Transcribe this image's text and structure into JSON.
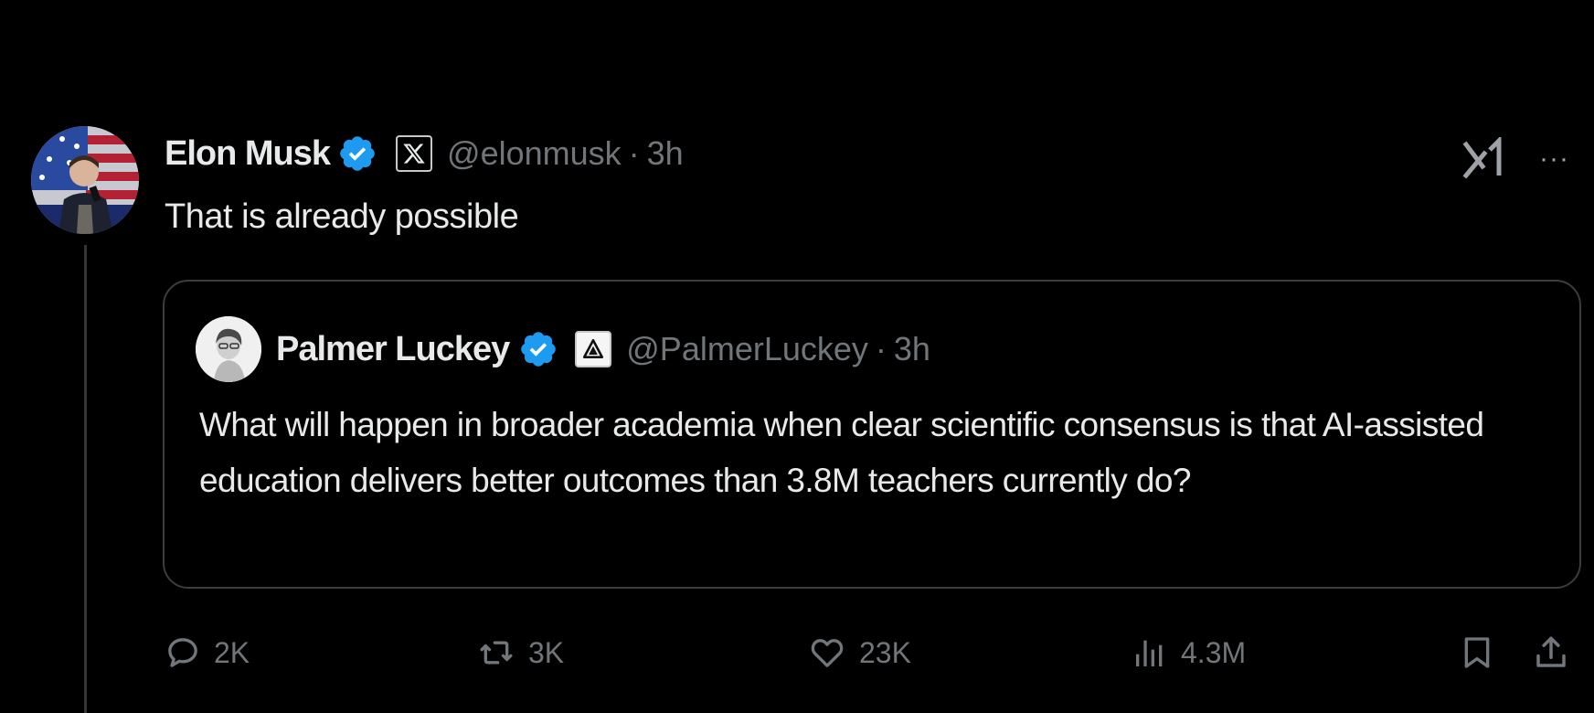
{
  "post": {
    "author": {
      "name": "Elon Musk",
      "handle": "@elonmusk",
      "time": "3h",
      "affiliation_icon": "x-logo-badge"
    },
    "text": "That is already possible",
    "quoted": {
      "author": {
        "name": "Palmer Luckey",
        "handle": "@PalmerLuckey",
        "time": "3h",
        "affiliation_icon": "anduril-logo-badge"
      },
      "text": "What will happen in broader academia when clear scientific consensus is that AI-assisted education delivers better outcomes than 3.8M teachers currently do?"
    },
    "actions": {
      "replies": "2K",
      "reposts": "3K",
      "likes": "23K",
      "views": "4.3M"
    }
  },
  "separator": "·",
  "colors": {
    "background": "#000000",
    "text_primary": "#e7e9ea",
    "text_secondary": "#71767b",
    "verified_blue": "#1d9bf0",
    "border": "#3a3d40"
  }
}
